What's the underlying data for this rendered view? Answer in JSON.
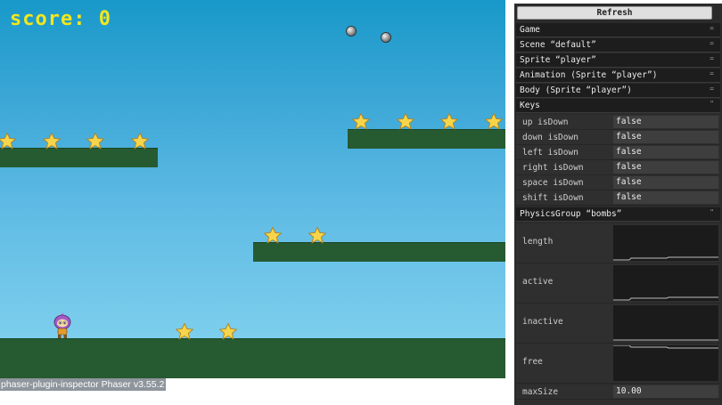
{
  "game": {
    "score_text": "score: 0",
    "footer_plugin": "phaser-plugin-inspector",
    "footer_version": "Phaser v3.55.2"
  },
  "inspector": {
    "refresh_label": "Refresh",
    "folders": [
      {
        "label": "Game",
        "state": "="
      },
      {
        "label": "Scene “default”",
        "state": "="
      },
      {
        "label": "Sprite “player”",
        "state": "="
      },
      {
        "label": "Animation (Sprite “player”)",
        "state": "="
      },
      {
        "label": "Body (Sprite “player”)",
        "state": "="
      },
      {
        "label": "Keys",
        "state": "\""
      }
    ],
    "keys": [
      {
        "label": "up isDown",
        "value": "false"
      },
      {
        "label": "down isDown",
        "value": "false"
      },
      {
        "label": "left isDown",
        "value": "false"
      },
      {
        "label": "right isDown",
        "value": "false"
      },
      {
        "label": "space isDown",
        "value": "false"
      },
      {
        "label": "shift isDown",
        "value": "false"
      }
    ],
    "bombs_folder": {
      "label": "PhysicsGroup “bombs”",
      "state": "\""
    },
    "monitors": [
      {
        "label": "length"
      },
      {
        "label": "active"
      },
      {
        "label": "inactive"
      },
      {
        "label": "free"
      }
    ],
    "maxsize": {
      "label": "maxSize",
      "value": "10.00"
    }
  },
  "colors": {
    "platform": "#265a31",
    "score": "#f3e71d",
    "sky_top": "#1899c9",
    "sky_bottom": "#86d4ef",
    "panel_bg": "#2b2b2b"
  }
}
